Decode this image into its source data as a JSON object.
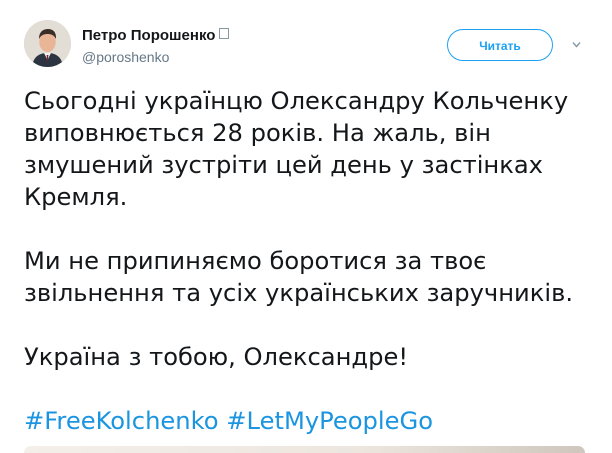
{
  "header": {
    "display_name": "Петро Порошенко",
    "verified_glyph": "",
    "handle": "@poroshenko",
    "follow_label": "Читать",
    "avatar_icon": "user-avatar",
    "menu_icon": "chevron-down-icon"
  },
  "tweet": {
    "lines_p1": [
      "Сьогодні українцю Олександру Кольченку",
      "виповнюється 28 років. На жаль, він",
      "змушений зустріти цей день у застінках",
      "Кремля."
    ],
    "lines_p2": [
      "Ми не припиняємо боротися за твоє",
      "звільнення та усіх українських заручників."
    ],
    "line_p3": "Україна з тобою, Олександре!",
    "hashtags": [
      "#FreeKolchenko",
      "#LetMyPeopleGo"
    ]
  },
  "colors": {
    "accent": "#1da1f2",
    "hashtag": "#1b95e0",
    "text": "#14171a",
    "secondary": "#657786"
  }
}
